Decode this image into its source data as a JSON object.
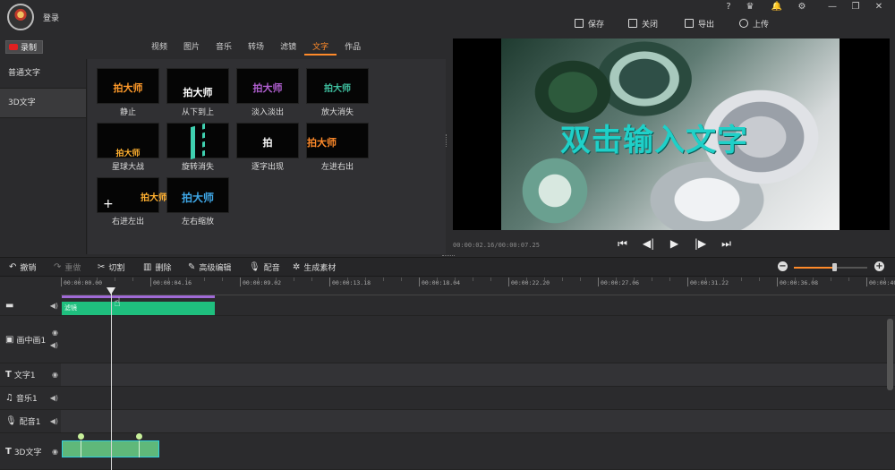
{
  "header": {
    "login_label": "登录",
    "window_controls": [
      "?",
      "♛",
      "🔔",
      "⚙",
      "—",
      "❐",
      "✕"
    ],
    "actions": [
      {
        "label": "保存",
        "icon": "save-icon"
      },
      {
        "label": "关闭",
        "icon": "close-project-icon"
      },
      {
        "label": "导出",
        "icon": "export-icon"
      },
      {
        "label": "上传",
        "icon": "upload-icon"
      }
    ]
  },
  "record_button": {
    "label": "录制"
  },
  "category_tabs": [
    {
      "label": "视频"
    },
    {
      "label": "图片"
    },
    {
      "label": "音乐"
    },
    {
      "label": "转场"
    },
    {
      "label": "滤镜"
    },
    {
      "label": "文字",
      "active": true
    },
    {
      "label": "作品"
    }
  ],
  "text_types": [
    {
      "label": "普通文字"
    },
    {
      "label": "3D文字",
      "active": true
    }
  ],
  "effects": [
    {
      "thumb_text": "拍大师",
      "label": "静止",
      "color": "#ff9a2a"
    },
    {
      "thumb_text": "拍大师",
      "label": "从下到上",
      "color": "#ffffff"
    },
    {
      "thumb_text": "拍大师",
      "label": "淡入淡出",
      "color": "#b05fd0"
    },
    {
      "thumb_text": "拍大师",
      "label": "放大消失",
      "color": "#3fc0a0"
    },
    {
      "thumb_text": "拍大师",
      "label": "星球大战",
      "color": "#ffb030"
    },
    {
      "thumb_text": "",
      "label": "旋转消失",
      "color": "#3fd0b0"
    },
    {
      "thumb_text": "拍",
      "label": "逐字出现",
      "color": "#ffffff"
    },
    {
      "thumb_text": "拍大师",
      "label": "左进右出",
      "color": "#ff8a2a"
    },
    {
      "thumb_text": "拍大师",
      "label": "右进左出",
      "color": "#ffb030"
    },
    {
      "thumb_text": "拍大师",
      "label": "左右缩放",
      "color": "#3fa8e8"
    }
  ],
  "preview": {
    "overlay_text": "双击输入文字",
    "time": "00:00:02.16/00:00:07.25"
  },
  "toolbar": [
    {
      "label": "撤销",
      "icon": "undo-icon",
      "disabled": false
    },
    {
      "label": "重做",
      "icon": "redo-icon",
      "disabled": true
    },
    {
      "label": "切割",
      "icon": "scissors-icon",
      "disabled": false
    },
    {
      "label": "删除",
      "icon": "trash-icon",
      "disabled": false
    },
    {
      "label": "高级编辑",
      "icon": "pencil-icon",
      "disabled": false
    },
    {
      "label": "配音",
      "icon": "microphone-icon",
      "disabled": false
    },
    {
      "label": "生成素材",
      "icon": "film-reel-icon",
      "disabled": false
    }
  ],
  "zoom": {
    "level": 0.55
  },
  "ruler": [
    "00:00:00.00",
    "00:00:04.16",
    "00:00:09.02",
    "00:00:13.18",
    "00:00:18.04",
    "00:00:22.20",
    "00:00:27.06",
    "00:00:31.22",
    "00:00:36.08",
    "00:00:40."
  ],
  "tracks": [
    {
      "label": "",
      "clip_label": "滤镜"
    },
    {
      "label": "画中画1"
    },
    {
      "label": "文字1"
    },
    {
      "label": "音乐1"
    },
    {
      "label": "配音1"
    },
    {
      "label": "3D文字"
    }
  ]
}
